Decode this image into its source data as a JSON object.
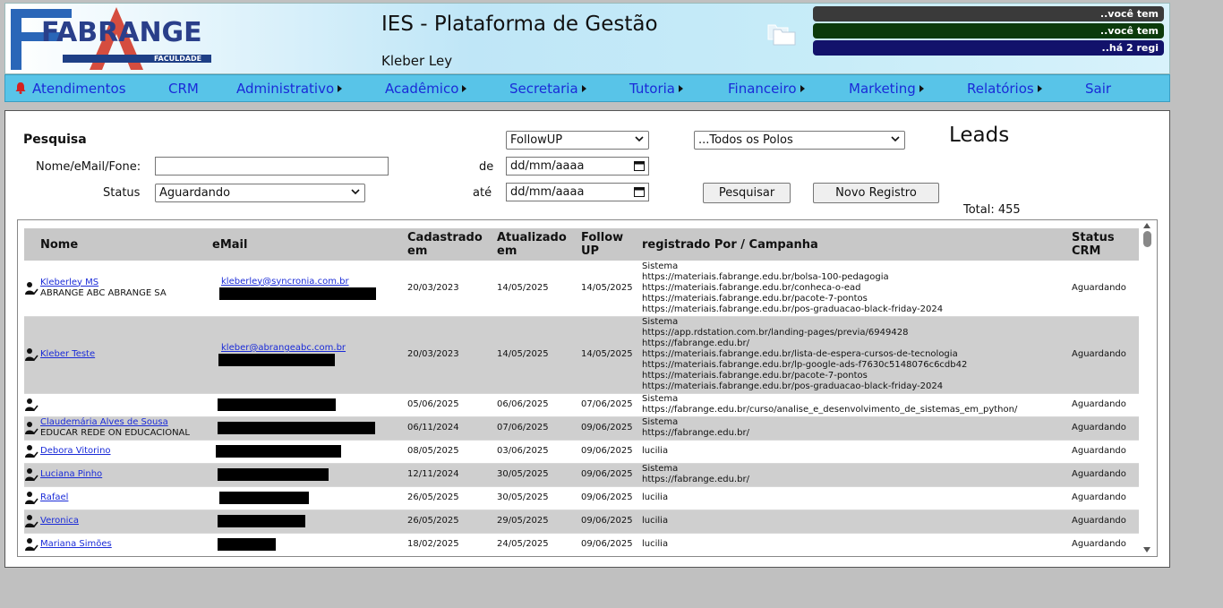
{
  "header": {
    "logo_text": "FABRANGE",
    "logo_sub": "FACULDADE",
    "app_title": "IES - Plataforma de Gestão",
    "user_name": "Kleber Ley",
    "notices": [
      "..você tem",
      "..você tem",
      "..há 2 regi"
    ]
  },
  "nav": {
    "items": [
      {
        "label": "Atendimentos",
        "has_submenu": false
      },
      {
        "label": "CRM",
        "has_submenu": false
      },
      {
        "label": "Administrativo",
        "has_submenu": true
      },
      {
        "label": "Acadêmico",
        "has_submenu": true
      },
      {
        "label": "Secretaria",
        "has_submenu": true
      },
      {
        "label": "Tutoria",
        "has_submenu": true
      },
      {
        "label": "Financeiro",
        "has_submenu": true
      },
      {
        "label": "Marketing",
        "has_submenu": true
      },
      {
        "label": "Relatórios",
        "has_submenu": true
      },
      {
        "label": "Sair",
        "has_submenu": false
      }
    ]
  },
  "search": {
    "title": "Pesquisa",
    "name_label": "Nome/eMail/Fone:",
    "name_value": "",
    "status_label": "Status",
    "status_value": "Aguardando",
    "followup_value": "FollowUP",
    "polo_value": "...Todos os Polos",
    "from_label": "de",
    "from_value": "dd/mm/aaaa",
    "to_label": "até",
    "to_value": "dd/mm/aaaa",
    "search_button": "Pesquisar",
    "new_button": "Novo Registro"
  },
  "leads": {
    "title": "Leads",
    "total_label": "Total: 455"
  },
  "table": {
    "headers": {
      "name": "Nome",
      "email": "eMail",
      "created": "Cadastrado em",
      "updated": "Atualizado em",
      "followup": "Follow UP",
      "registered": "registrado Por / Campanha",
      "status": "Status CRM"
    },
    "rows": [
      {
        "name": "Kleberley MS",
        "sub": "ABRANGE ABC ABRANGE SA",
        "email": "kleberley@syncronia.com.br",
        "created": "20/03/2023",
        "updated": "14/05/2025",
        "followup": "14/05/2025",
        "registered": [
          "Sistema",
          "https://materiais.fabrange.edu.br/bolsa-100-pedagogia",
          "https://materiais.fabrange.edu.br/conheca-o-ead",
          "https://materiais.fabrange.edu.br/pacote-7-pontos",
          "https://materiais.fabrange.edu.br/pos-graduacao-black-friday-2024"
        ],
        "status": "Aguardando"
      },
      {
        "name": "Kleber Teste",
        "sub": "",
        "email": "kleber@abrangeabc.com.br",
        "created": "20/03/2023",
        "updated": "14/05/2025",
        "followup": "14/05/2025",
        "registered": [
          "Sistema",
          "https://app.rdstation.com.br/landing-pages/previa/6949428",
          "https://fabrange.edu.br/",
          "https://materiais.fabrange.edu.br/lista-de-espera-cursos-de-tecnologia",
          "https://materiais.fabrange.edu.br/lp-google-ads-f7630c5148076c6cdb42",
          "https://materiais.fabrange.edu.br/pacote-7-pontos",
          "https://materiais.fabrange.edu.br/pos-graduacao-black-friday-2024"
        ],
        "status": "Aguardando"
      },
      {
        "name": "",
        "sub": "",
        "email": "",
        "created": "05/06/2025",
        "updated": "06/06/2025",
        "followup": "07/06/2025",
        "registered": [
          "Sistema",
          "https://fabrange.edu.br/curso/analise_e_desenvolvimento_de_sistemas_em_python/"
        ],
        "status": "Aguardando"
      },
      {
        "name": "Claudemária Alves de Sousa",
        "sub": "EDUCAR REDE ON EDUCACIONAL",
        "email": "",
        "created": "06/11/2024",
        "updated": "07/06/2025",
        "followup": "09/06/2025",
        "registered": [
          "Sistema",
          "https://fabrange.edu.br/"
        ],
        "status": "Aguardando"
      },
      {
        "name": "Debora Vitorino",
        "sub": "",
        "email": "",
        "created": "08/05/2025",
        "updated": "03/06/2025",
        "followup": "09/06/2025",
        "registered": [
          "lucilia"
        ],
        "status": "Aguardando"
      },
      {
        "name": "Luciana Pinho",
        "sub": "",
        "email": "",
        "created": "12/11/2024",
        "updated": "30/05/2025",
        "followup": "09/06/2025",
        "registered": [
          "Sistema",
          "https://fabrange.edu.br/"
        ],
        "status": "Aguardando"
      },
      {
        "name": "Rafael",
        "sub": "",
        "email": "",
        "created": "26/05/2025",
        "updated": "30/05/2025",
        "followup": "09/06/2025",
        "registered": [
          "lucilia"
        ],
        "status": "Aguardando"
      },
      {
        "name": "Veronica",
        "sub": "",
        "email": "",
        "created": "26/05/2025",
        "updated": "29/05/2025",
        "followup": "09/06/2025",
        "registered": [
          "lucilia"
        ],
        "status": "Aguardando"
      },
      {
        "name": "Mariana Simões",
        "sub": "",
        "email": "",
        "created": "18/02/2025",
        "updated": "24/05/2025",
        "followup": "09/06/2025",
        "registered": [
          "lucilia"
        ],
        "status": "Aguardando"
      }
    ]
  },
  "colors": {
    "nav_bg": "#58c4e8",
    "link": "#1a2bd8",
    "row_alt": "#cfcfcf",
    "header_bg": "#c8c8c8"
  }
}
